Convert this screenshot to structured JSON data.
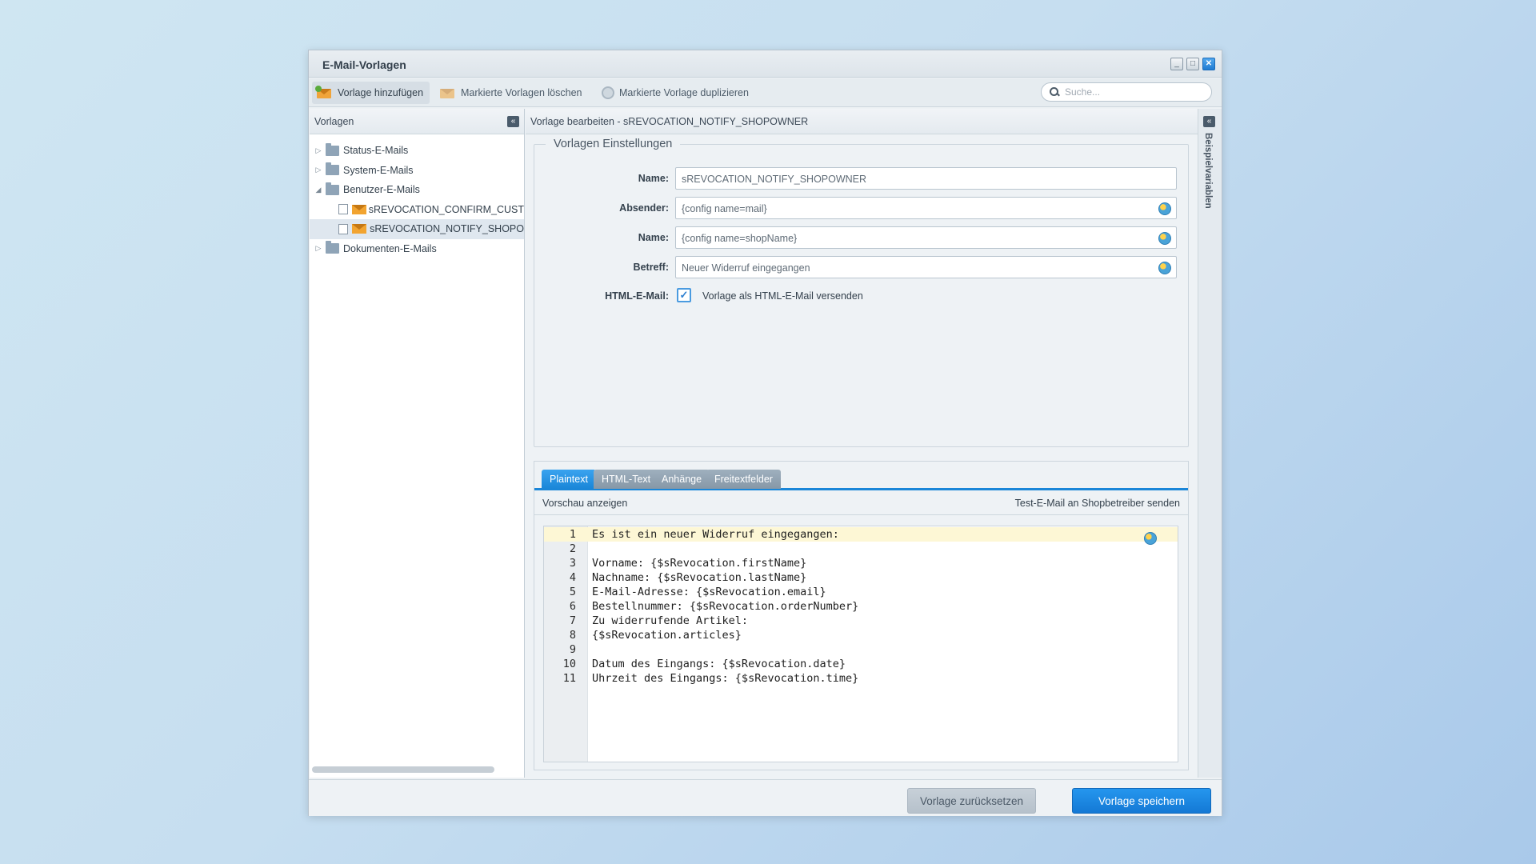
{
  "window": {
    "title": "E-Mail-Vorlagen",
    "controls": [
      "minimize",
      "maximize",
      "close"
    ]
  },
  "toolbar": {
    "add_label": "Vorlage hinzufügen",
    "delete_label": "Markierte Vorlagen löschen",
    "duplicate_label": "Markierte Vorlage duplizieren",
    "search_placeholder": "Suche..."
  },
  "left_panel": {
    "title": "Vorlagen",
    "tree": [
      {
        "label": "Status-E-Mails",
        "expanded": false
      },
      {
        "label": "System-E-Mails",
        "expanded": false
      },
      {
        "label": "Benutzer-E-Mails",
        "expanded": true
      },
      {
        "label": "sREVOCATION_CONFIRM_CUST",
        "child": true
      },
      {
        "label": "sREVOCATION_NOTIFY_SHOPO",
        "child": true,
        "selected": true
      },
      {
        "label": "Dokumenten-E-Mails",
        "expanded": false
      }
    ]
  },
  "main": {
    "header": "Vorlage bearbeiten - sREVOCATION_NOTIFY_SHOPOWNER",
    "section_title": "Vorlagen Einstellungen",
    "fields": {
      "name_label": "Name:",
      "name_value": "sREVOCATION_NOTIFY_SHOPOWNER",
      "sender_label": "Absender:",
      "sender_value": "{config name=mail}",
      "sender_name_label": "Name:",
      "sender_name_value": "{config name=shopName}",
      "subject_label": "Betreff:",
      "subject_value": "Neuer Widerruf eingegangen",
      "html_label": "HTML-E-Mail:",
      "html_checked": true,
      "html_checkbox_text": "Vorlage als HTML-E-Mail versenden"
    },
    "tabs": [
      "Plaintext",
      "HTML-Text",
      "Anhänge",
      "Freitextfelder"
    ],
    "active_tab": "Plaintext",
    "editor_toolbar": {
      "preview": "Vorschau anzeigen",
      "test_mail": "Test-E-Mail an Shopbetreiber senden"
    },
    "code_lines": [
      {
        "n": "1",
        "text": "Es ist ein neuer Widerruf eingegangen:"
      },
      {
        "n": "2",
        "text": ""
      },
      {
        "n": "3",
        "text": "Vorname: {$sRevocation.firstName}"
      },
      {
        "n": "4",
        "text": "Nachname: {$sRevocation.lastName}"
      },
      {
        "n": "5",
        "text": "E-Mail-Adresse: {$sRevocation.email}"
      },
      {
        "n": "6",
        "text": "Bestellnummer: {$sRevocation.orderNumber}"
      },
      {
        "n": "7",
        "text": "Zu widerrufende Artikel:"
      },
      {
        "n": "8",
        "text": "{$sRevocation.articles}"
      },
      {
        "n": "9",
        "text": ""
      },
      {
        "n": "10",
        "text": "Datum des Eingangs: {$sRevocation.date}"
      },
      {
        "n": "11",
        "text": "Uhrzeit des Eingangs: {$sRevocation.time}"
      }
    ]
  },
  "side_panel": {
    "title": "Beispielvariablen"
  },
  "footer": {
    "reset_label": "Vorlage zurücksetzen",
    "save_label": "Vorlage speichern"
  },
  "colors": {
    "accent": "#1a86d8",
    "highlight_line": "#fdf7d5"
  }
}
